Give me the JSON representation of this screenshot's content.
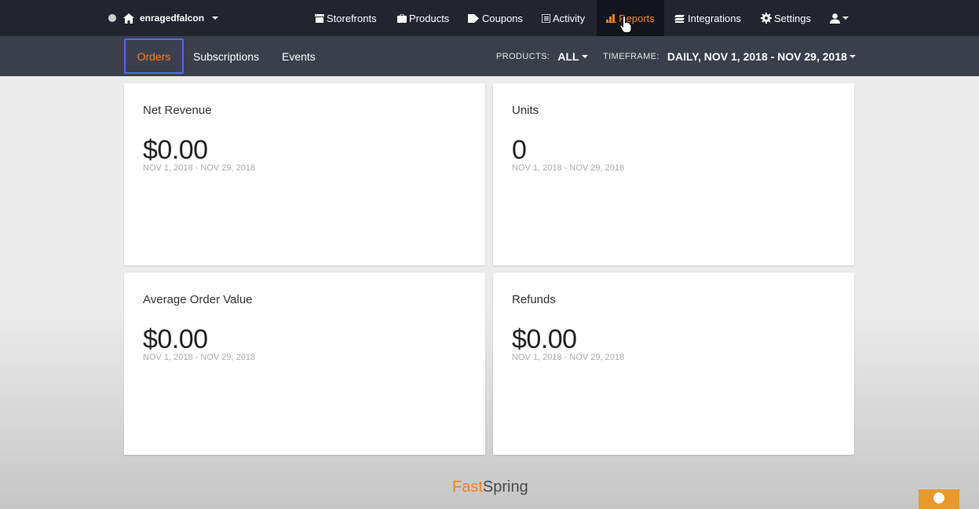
{
  "store": {
    "name": "enragedfalcon"
  },
  "nav": {
    "storefronts": "Storefronts",
    "products": "Products",
    "coupons": "Coupons",
    "activity": "Activity",
    "reports": "Reports",
    "integrations": "Integrations",
    "settings": "Settings"
  },
  "tabs": {
    "orders": "Orders",
    "subscriptions": "Subscriptions",
    "events": "Events"
  },
  "filters": {
    "products_label": "PRODUCTS:",
    "products_value": "ALL",
    "timeframe_label": "TIMEFRAME:",
    "timeframe_value": "DAILY, NOV 1, 2018 - NOV 29, 2018"
  },
  "cards": [
    {
      "title": "Net Revenue",
      "value": "$0.00",
      "range": "NOV 1, 2018 - NOV 29, 2018"
    },
    {
      "title": "Units",
      "value": "0",
      "range": "NOV 1, 2018 - NOV 29, 2018"
    },
    {
      "title": "Average Order Value",
      "value": "$0.00",
      "range": "NOV 1, 2018 - NOV 29, 2018"
    },
    {
      "title": "Refunds",
      "value": "$0.00",
      "range": "NOV 1, 2018 - NOV 29, 2018"
    }
  ],
  "brand": {
    "fast": "Fast",
    "spring": "Spring"
  },
  "colors": {
    "accent": "#f58220",
    "topbar": "#222530",
    "subbar": "#3b3f4c",
    "focus": "#4a6cf7"
  }
}
